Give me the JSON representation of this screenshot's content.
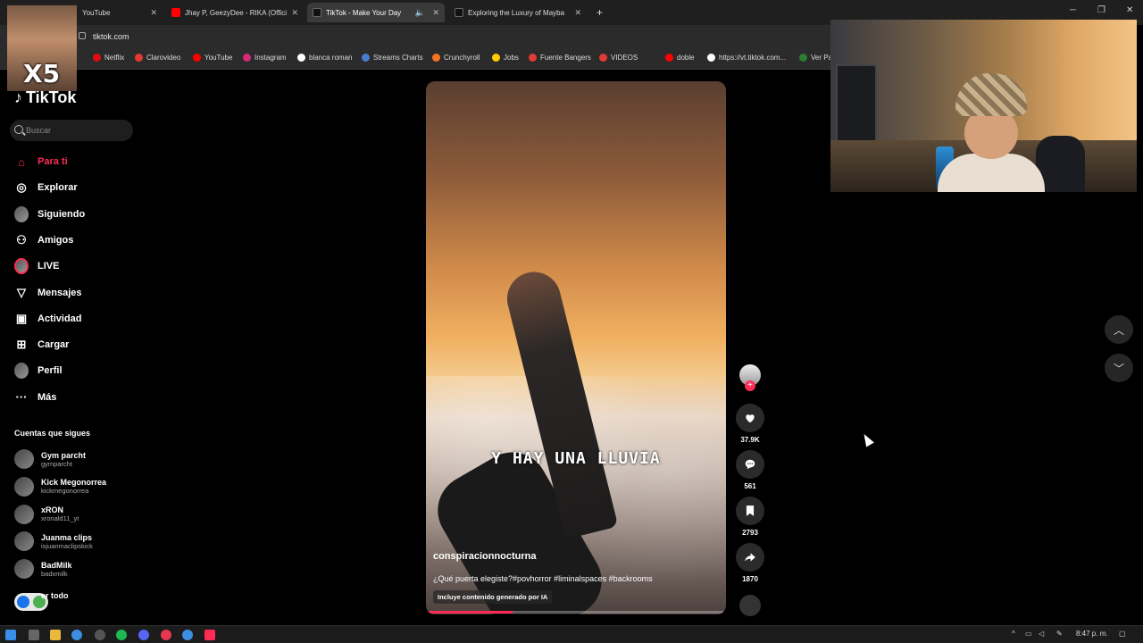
{
  "browser": {
    "tabs": [
      {
        "title": "YouTube",
        "color": "#ff0000"
      },
      {
        "title": "Jhay P, GeezyDee - RIKA (Offici",
        "color": "#ff0000"
      },
      {
        "title": "TikTok - Make Your Day",
        "color": "#111111"
      },
      {
        "title": "Exploring the Luxury of Mayba",
        "color": "#111111"
      }
    ],
    "new_tab": "+",
    "url": "tiktok.com",
    "bookmarks": [
      {
        "label": "Netflix",
        "color": "#e50914"
      },
      {
        "label": "Clarovideo",
        "color": "#e53935"
      },
      {
        "label": "YouTube",
        "color": "#ff0000"
      },
      {
        "label": "Instagram",
        "color": "#d62976"
      },
      {
        "label": "blanca roman",
        "color": "#ffffff"
      },
      {
        "label": "Streams Charts",
        "color": "#4a7bd0"
      },
      {
        "label": "Crunchyroll",
        "color": "#f47521"
      },
      {
        "label": "Jobs",
        "color": "#ffcc00"
      },
      {
        "label": "Fuente Bangers",
        "color": "#e53935"
      },
      {
        "label": "VIDEOS",
        "color": "#e53935"
      },
      {
        "label": "doble",
        "color": "#ff0000"
      },
      {
        "label": "https://vt.tiktok.com...",
        "color": "#ffffff"
      },
      {
        "label": "Ver Pa",
        "color": "#2e7d32"
      }
    ]
  },
  "overlay": {
    "meme_text": "X5"
  },
  "sidebar": {
    "logo": "TikTok",
    "search_placeholder": "Buscar",
    "nav": [
      {
        "label": "Para ti",
        "icon": "home-icon",
        "active": true
      },
      {
        "label": "Explorar",
        "icon": "compass-icon"
      },
      {
        "label": "Siguiendo",
        "icon": "following-avatar"
      },
      {
        "label": "Amigos",
        "icon": "friends-icon"
      },
      {
        "label": "LIVE",
        "icon": "live-icon"
      },
      {
        "label": "Mensajes",
        "icon": "messages-icon"
      },
      {
        "label": "Actividad",
        "icon": "activity-icon"
      },
      {
        "label": "Cargar",
        "icon": "upload-icon"
      },
      {
        "label": "Perfil",
        "icon": "profile-avatar"
      },
      {
        "label": "Más",
        "icon": "more-icon"
      }
    ],
    "follows_title": "Cuentas que sigues",
    "follows": [
      {
        "name": "Gym parcht",
        "handle": "gymparcht"
      },
      {
        "name": "Kick Megonorrea",
        "handle": "kickmegonorrea"
      },
      {
        "name": "xRON",
        "handle": "xronald11_yt"
      },
      {
        "name": "Juanma clips",
        "handle": "isjuanmaclipskick"
      },
      {
        "name": "BadMilk",
        "handle": "badxmilk"
      }
    ],
    "see_all": "er todo"
  },
  "video": {
    "caption": "Y HAY UNA LLUVIA",
    "author": "conspiracionnocturna",
    "description": "¿Qué puerta elegiste?#povhorror #liminalspaces #backrooms",
    "ai_badge": "Incluye contenido generado por IA",
    "progress": 0.29
  },
  "actions": {
    "likes": "37.9K",
    "comments": "561",
    "saves": "2793",
    "shares": "1870"
  },
  "taskbar": {
    "time": "8:47 p. m."
  }
}
